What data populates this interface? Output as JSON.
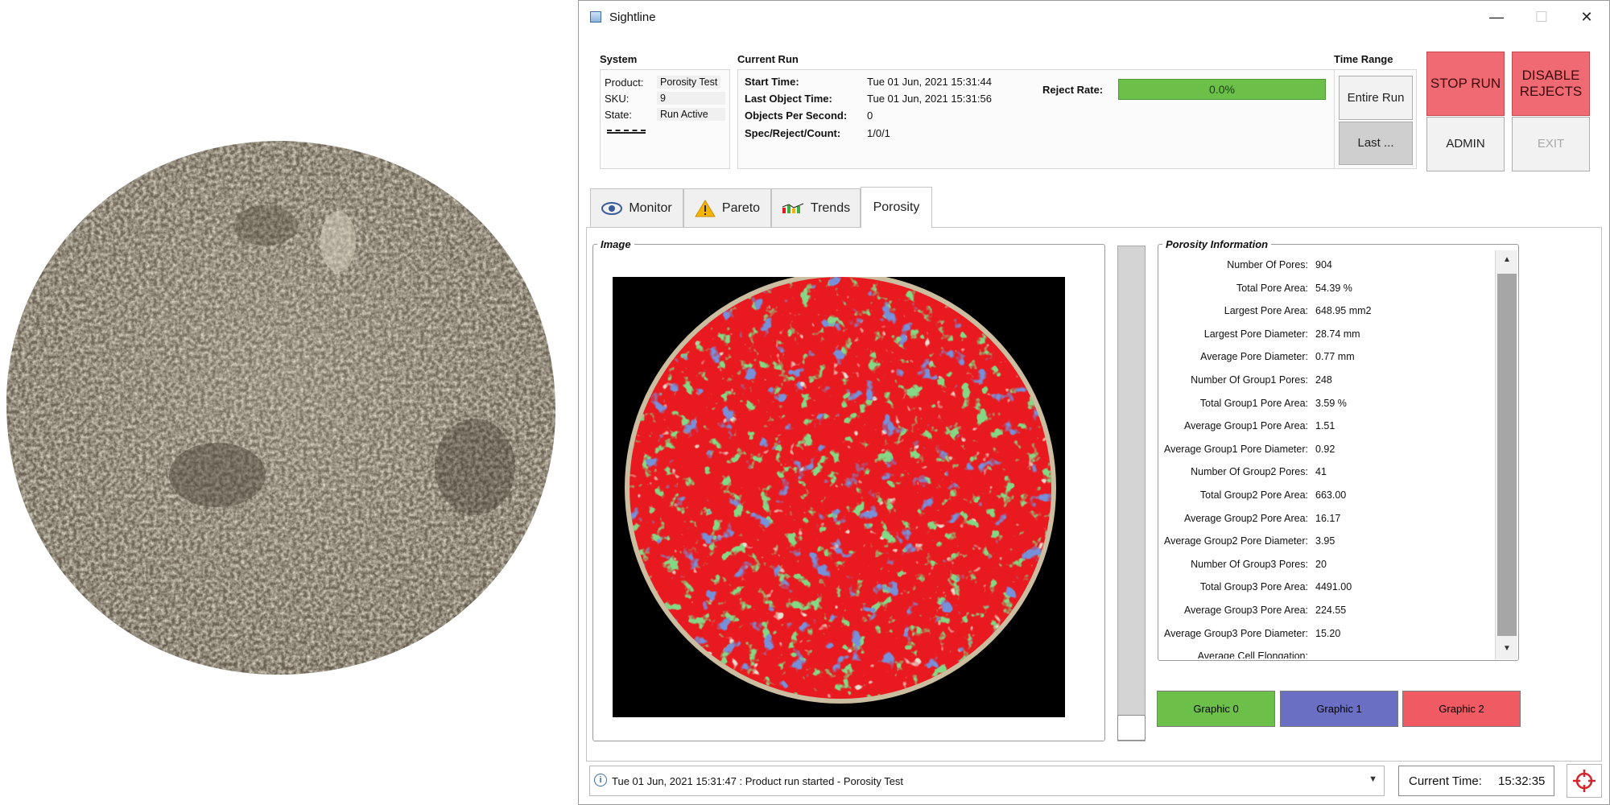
{
  "window": {
    "title": "Sightline",
    "controls": {
      "minimize": "—",
      "maximize": "☐",
      "close": "✕"
    }
  },
  "system": {
    "heading": "System",
    "product_label": "Product:",
    "product_value": "Porosity Test",
    "sku_label": "SKU:",
    "sku_value": "9",
    "state_label": "State:",
    "state_value": "Run Active"
  },
  "current_run": {
    "heading": "Current Run",
    "start_label": "Start Time:",
    "start_value": "Tue 01 Jun, 2021 15:31:44",
    "last_label": "Last Object Time:",
    "last_value": "Tue 01 Jun, 2021 15:31:56",
    "ops_label": "Objects Per Second:",
    "ops_value": "0",
    "count_label": "Spec/Reject/Count:",
    "count_value": "1/0/1",
    "reject_rate_label": "Reject Rate:",
    "reject_rate_value": "0.0%",
    "reject_rate_fill": 1.0
  },
  "time_range": {
    "heading": "Time Range",
    "entire_run": "Entire Run",
    "last": "Last ..."
  },
  "actions": {
    "stop_run": "STOP RUN",
    "disable_rejects": "DISABLE REJECTS",
    "admin": "ADMIN",
    "exit": "EXIT"
  },
  "tabs": [
    {
      "label": "Monitor",
      "icon": "eye-icon"
    },
    {
      "label": "Pareto",
      "icon": "warning-icon"
    },
    {
      "label": "Trends",
      "icon": "trends-icon"
    },
    {
      "label": "Porosity",
      "icon": ""
    }
  ],
  "image_panel": {
    "label": "Image"
  },
  "porosity_info": {
    "label": "Porosity Information",
    "rows": [
      {
        "label": "Number Of Pores:",
        "value": "904"
      },
      {
        "label": "Total Pore Area:",
        "value": "54.39 %"
      },
      {
        "label": "Largest Pore Area:",
        "value": "648.95 mm2"
      },
      {
        "label": "Largest Pore Diameter:",
        "value": "28.74 mm"
      },
      {
        "label": "Average Pore Diameter:",
        "value": "0.77 mm"
      },
      {
        "label": "Number Of Group1 Pores:",
        "value": "248"
      },
      {
        "label": "Total Group1 Pore Area:",
        "value": "3.59 %"
      },
      {
        "label": "Average Group1 Pore Area:",
        "value": "1.51"
      },
      {
        "label": "Average Group1 Pore Diameter:",
        "value": "0.92"
      },
      {
        "label": "Number Of Group2 Pores:",
        "value": "41"
      },
      {
        "label": "Total Group2 Pore Area:",
        "value": "663.00"
      },
      {
        "label": "Average Group2 Pore Area:",
        "value": "16.17"
      },
      {
        "label": "Average Group2 Pore Diameter:",
        "value": "3.95"
      },
      {
        "label": "Number Of Group3 Pores:",
        "value": "20"
      },
      {
        "label": "Total Group3 Pore Area:",
        "value": "4491.00"
      },
      {
        "label": "Average Group3 Pore Area:",
        "value": "224.55"
      },
      {
        "label": "Average Group3 Pore Diameter:",
        "value": "15.20"
      },
      {
        "label": "Average Cell Elongation:",
        "value": ""
      }
    ]
  },
  "graphic_buttons": [
    {
      "label": "Graphic 0",
      "color": "#6cc04a"
    },
    {
      "label": "Graphic 1",
      "color": "#6b6fc4"
    },
    {
      "label": "Graphic 2",
      "color": "#ef5a63"
    }
  ],
  "status": {
    "message": "Tue 01 Jun, 2021 15:31:47 : Product run started - Porosity Test",
    "current_time_label": "Current Time:",
    "current_time_value": "15:32:35"
  },
  "colors": {
    "pore_red": "#e8191f",
    "pore_green": "#3fae3a",
    "pore_blue": "#2f47b3"
  }
}
